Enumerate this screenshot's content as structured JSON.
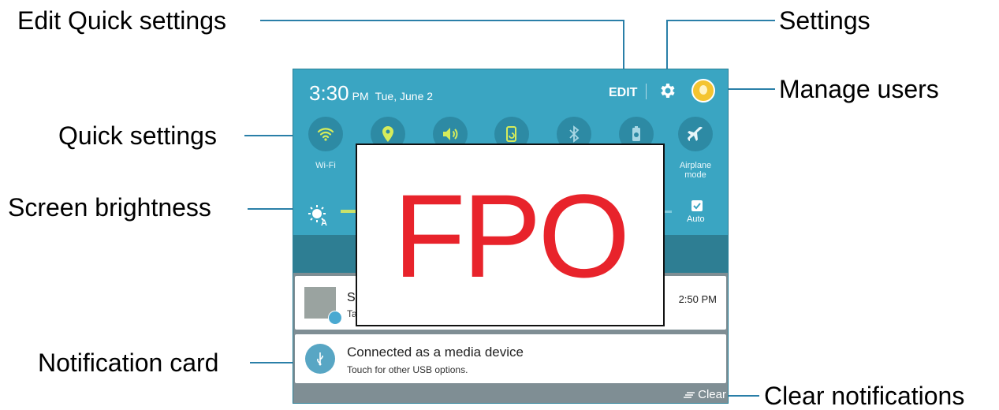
{
  "callouts": {
    "edit_quick_settings": "Edit Quick settings",
    "settings": "Settings",
    "manage_users": "Manage users",
    "quick_settings": "Quick settings",
    "screen_brightness": "Screen brightness",
    "notification_card": "Notification card",
    "clear_notifications": "Clear notifications"
  },
  "status_bar": {
    "time": "3:30",
    "ampm": "PM",
    "date": "Tue, June 2",
    "edit_label": "EDIT"
  },
  "quick_settings": {
    "tiles": [
      {
        "icon": "wifi-icon",
        "label": "Wi-Fi"
      },
      {
        "icon": "location-icon",
        "label": ""
      },
      {
        "icon": "sound-icon",
        "label": ""
      },
      {
        "icon": "screen-rotation-icon",
        "label": ""
      },
      {
        "icon": "bluetooth-icon",
        "label": ""
      },
      {
        "icon": "power-saving-icon",
        "label": ""
      },
      {
        "icon": "airplane-icon",
        "label": "Airplane mode"
      }
    ]
  },
  "brightness": {
    "auto_label": "Auto",
    "auto_checked": true,
    "level": 0.05
  },
  "notifications": [
    {
      "title": "Sc",
      "subtitle": "Ta",
      "time": "2:50 PM",
      "icon": "screenshot-thumbnail"
    },
    {
      "title": "Connected as a media device",
      "subtitle": "Touch for other USB options.",
      "icon": "usb-icon"
    }
  ],
  "clear_label": "Clear",
  "placeholder_text": "FPO",
  "colors": {
    "panel": "#3aa5c2",
    "tile_bg": "#2d8aa4",
    "band": "#2e7e93",
    "callout_line": "#2a7fa8",
    "fpo_text": "#e8232b"
  }
}
